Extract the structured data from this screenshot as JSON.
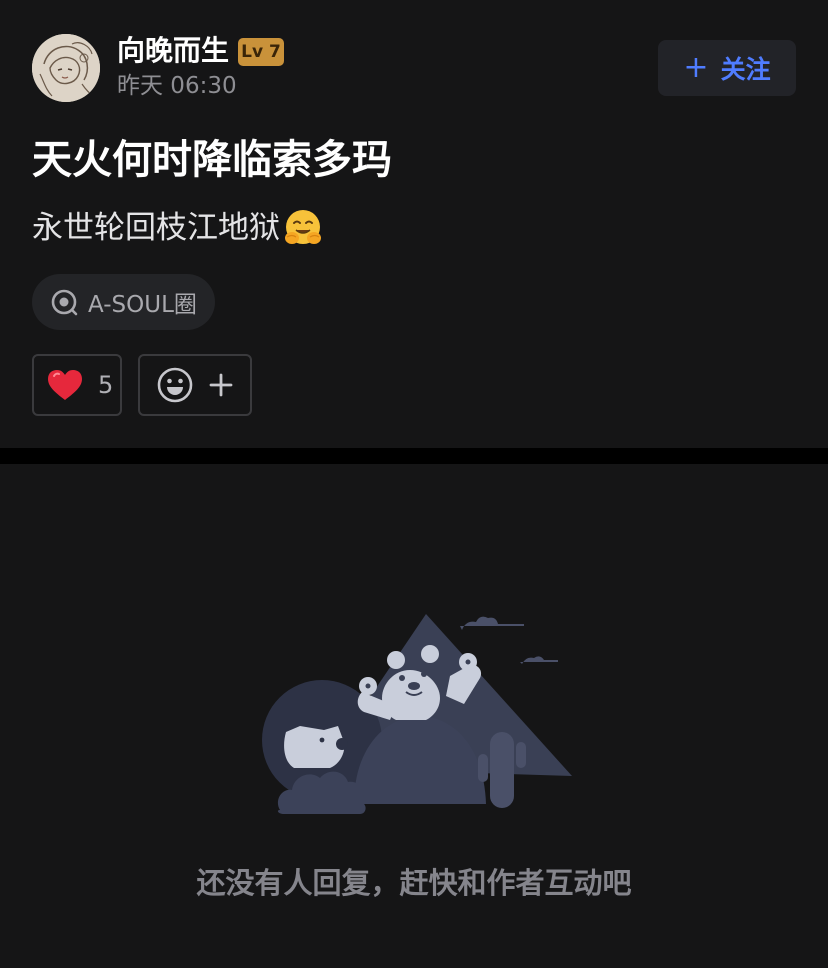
{
  "post": {
    "author": {
      "name": "向晚而生",
      "level": "Lv 7",
      "time": "昨天 06:30"
    },
    "follow_button": {
      "icon": "plus-icon",
      "label": "关注"
    },
    "title": "天火何时降临索多玛",
    "body": "永世轮回枝江地狱",
    "body_emoji": "hugging-face-icon",
    "circle_tag": {
      "icon": "circle-at-icon",
      "label": "A-SOUL圈"
    },
    "reactions": {
      "like_icon": "heart-icon",
      "like_count": "5",
      "add_icon": "smiley-plus-icon"
    }
  },
  "comments": {
    "empty_text": "还没有人回复，赶快和作者互动吧"
  },
  "colors": {
    "background": "#151516",
    "accent": "#4f7cff",
    "level_badge": "#c9923a"
  }
}
